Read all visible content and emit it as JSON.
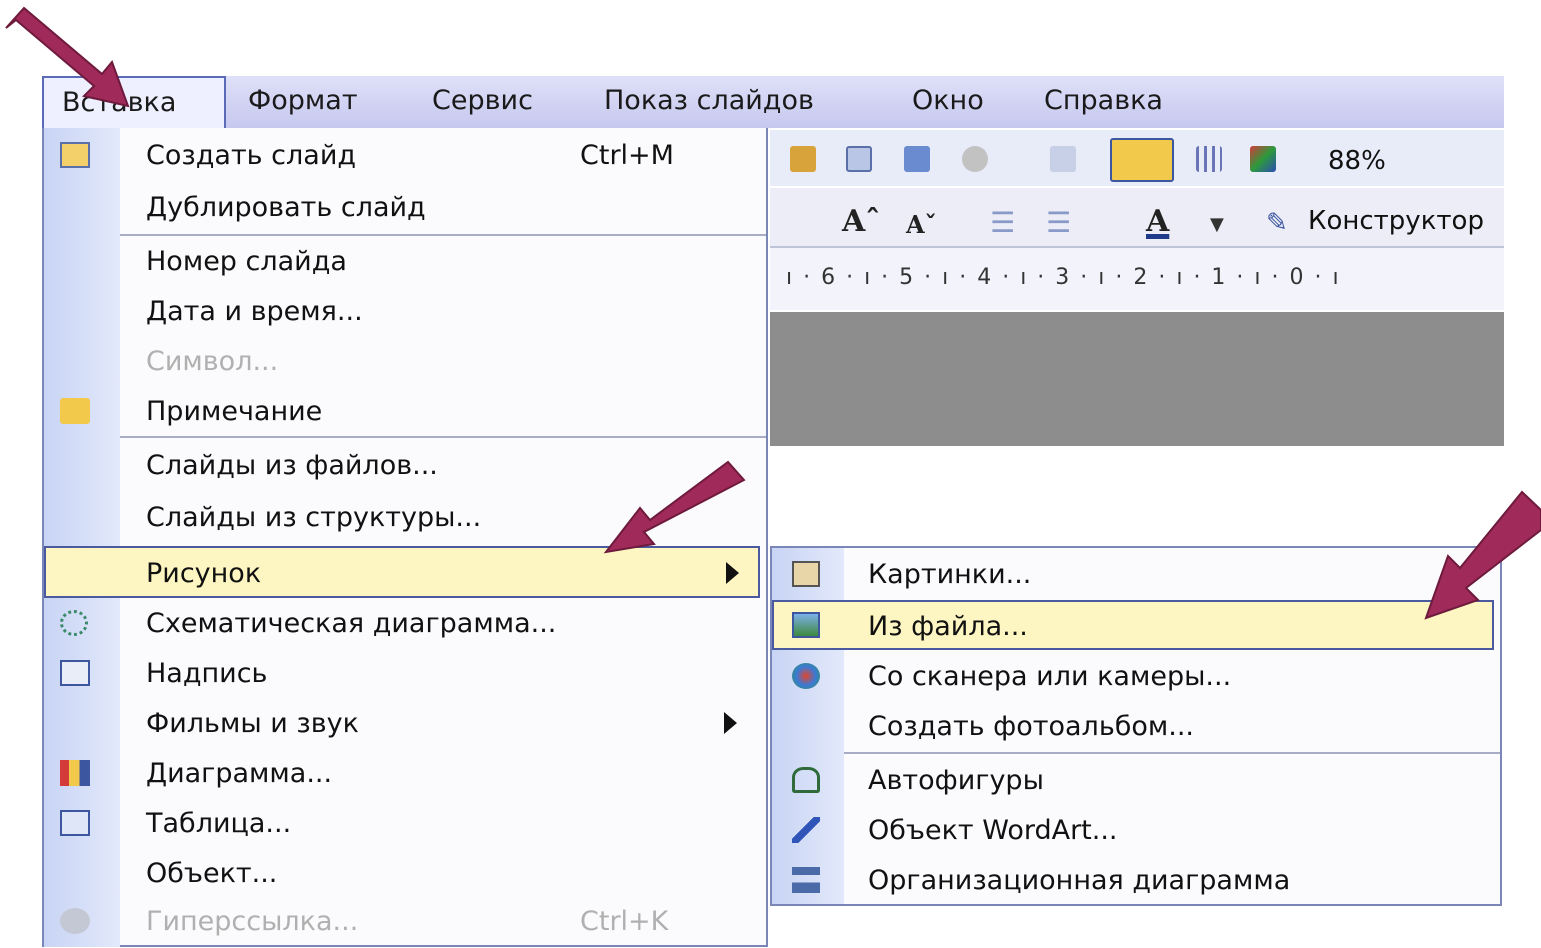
{
  "menubar": {
    "items": [
      "Вставка",
      "Формат",
      "Сервис",
      "Показ слайдов",
      "Окно",
      "Справка"
    ]
  },
  "toolbar": {
    "zoom": "88%",
    "design_label": "Конструктор"
  },
  "ruler": {
    "ticks": "ı · 6 · ı · 5 · ı · 4 · ı · 3 · ı · 2 · ı · 1 · ı · 0 · ı"
  },
  "insert_menu": {
    "items": [
      {
        "label": "Создать слайд",
        "shortcut": "Ctrl+M",
        "icon": "new-slide-icon"
      },
      {
        "label": "Дублировать слайд",
        "icon": ""
      },
      {
        "label": "Номер слайда",
        "icon": ""
      },
      {
        "label": "Дата и время...",
        "icon": ""
      },
      {
        "label": "Символ...",
        "icon": "",
        "disabled": true
      },
      {
        "label": "Примечание",
        "icon": "comment-icon"
      },
      {
        "label": "Слайды из файлов...",
        "icon": ""
      },
      {
        "label": "Слайды из структуры...",
        "icon": ""
      },
      {
        "label": "Рисунок",
        "icon": "",
        "submenu": true,
        "highlighted": true
      },
      {
        "label": "Схематическая диаграмма...",
        "icon": "diagram-icon"
      },
      {
        "label": "Надпись",
        "icon": "textbox-icon"
      },
      {
        "label": "Фильмы и звук",
        "icon": "",
        "submenu": true
      },
      {
        "label": "Диаграмма...",
        "icon": "chart-icon"
      },
      {
        "label": "Таблица...",
        "icon": "table-icon"
      },
      {
        "label": "Объект...",
        "icon": ""
      },
      {
        "label": "Гиперссылка...",
        "shortcut": "Ctrl+K",
        "icon": "hyperlink-icon",
        "disabled": true
      }
    ]
  },
  "picture_submenu": {
    "items": [
      {
        "label": "Картинки...",
        "icon": "clipart-icon"
      },
      {
        "label": "Из файла...",
        "icon": "picture-file-icon",
        "highlighted": true
      },
      {
        "label": "Со сканера или камеры...",
        "icon": "scanner-icon"
      },
      {
        "label": "Создать фотоальбом...",
        "icon": ""
      },
      {
        "label": "Автофигуры",
        "icon": "autoshapes-icon"
      },
      {
        "label": "Объект WordArt...",
        "icon": "wordart-icon"
      },
      {
        "label": "Организационная диаграмма",
        "icon": "org-chart-icon"
      }
    ]
  },
  "colors": {
    "highlight": "#fdf6c2",
    "menubar": "#c6c8ef",
    "arrow": "#a02a5a"
  }
}
